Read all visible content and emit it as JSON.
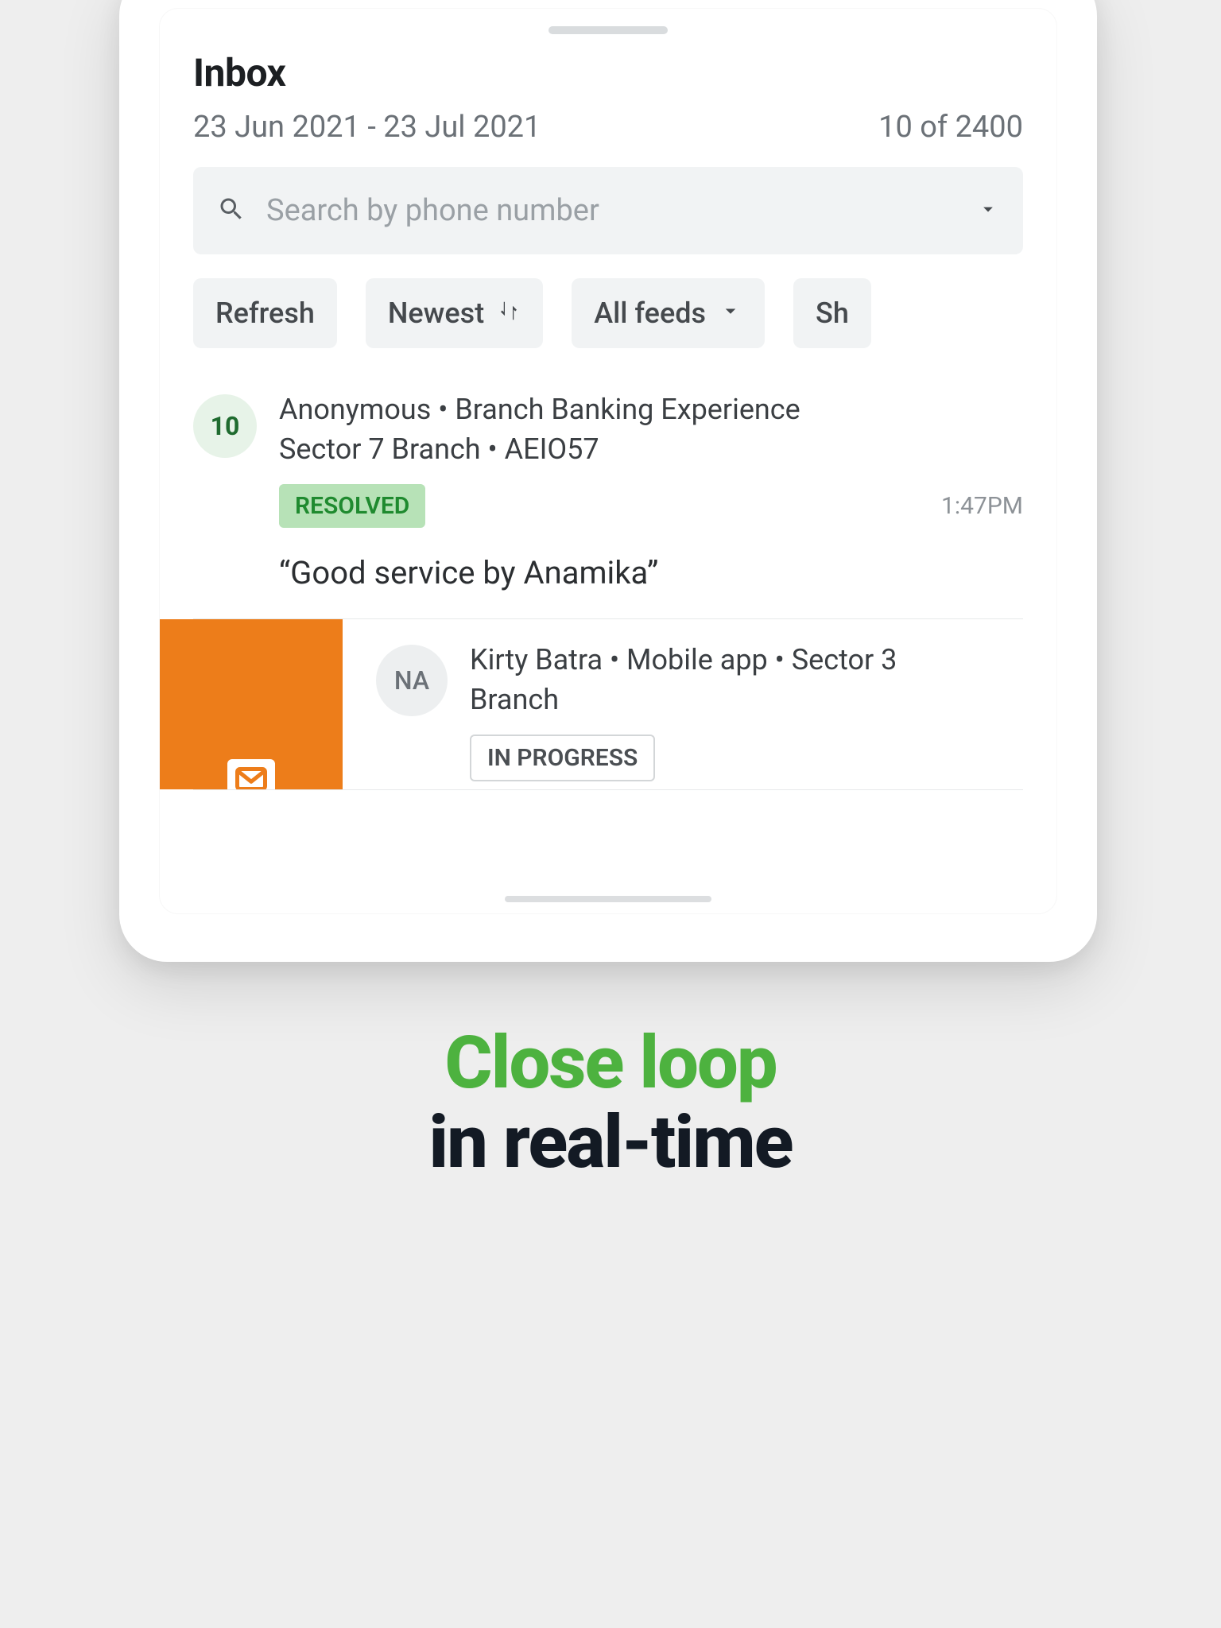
{
  "inbox": {
    "title": "Inbox",
    "dateRange": "23 Jun 2021 - 23 Jul 2021",
    "countLabel": "10 of 2400",
    "search": {
      "placeholder": "Search by phone number"
    },
    "chips": {
      "refresh": "Refresh",
      "sort": "Newest",
      "feeds": "All feeds",
      "partial": "Sh"
    },
    "items": [
      {
        "score": "10",
        "titleLine1": "Anonymous • Branch Banking Experience",
        "titleLine2": "Sector 7 Branch • AEIO57",
        "status": "RESOLVED",
        "time": "1:47PM",
        "quote": "“Good service by Anamika”"
      },
      {
        "score": "NA",
        "titleLine1": "Kirty Batra • Mobile app • Sector 3",
        "titleLine2": "Branch",
        "status": "IN PROGRESS"
      }
    ]
  },
  "hero": {
    "line1": "Close loop",
    "line2": "in real-time"
  }
}
